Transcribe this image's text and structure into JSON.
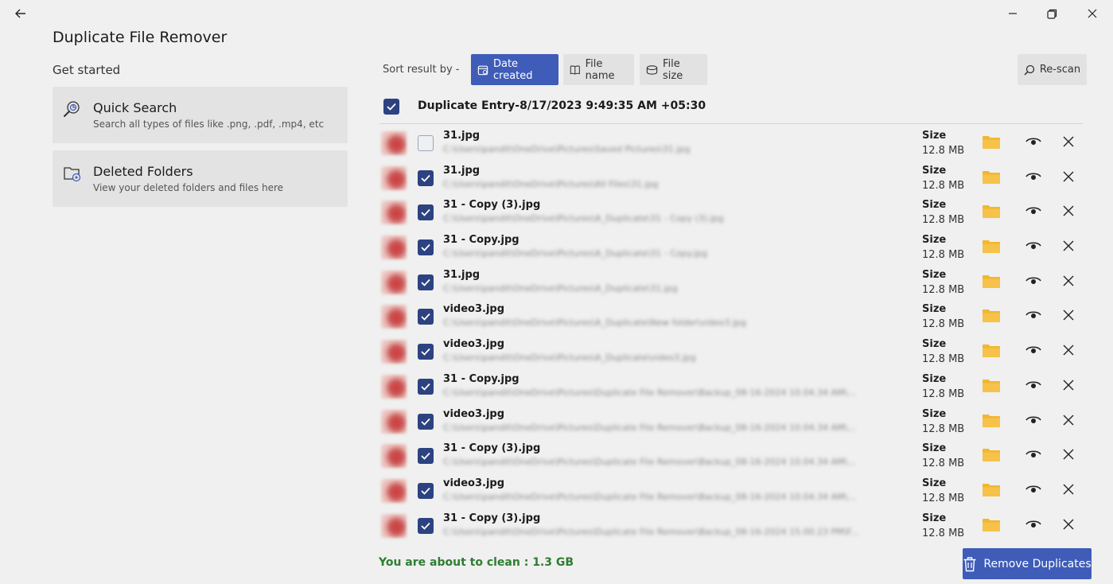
{
  "app": {
    "title": "Duplicate File Remover",
    "get_started": "Get started"
  },
  "sidebar": {
    "cards": [
      {
        "title": "Quick Search",
        "subtitle": "Search all types of files like .png, .pdf, .mp4, etc",
        "icon": "magnifier-search-icon"
      },
      {
        "title": "Deleted Folders",
        "subtitle": "View your deleted folders and files here",
        "icon": "folder-settings-icon"
      }
    ]
  },
  "sort": {
    "label": "Sort result by -",
    "options": [
      {
        "label": "Date created",
        "icon": "calendar-icon",
        "active": true
      },
      {
        "label": "File name",
        "icon": "book-icon",
        "active": false
      },
      {
        "label": "File size",
        "icon": "database-icon",
        "active": false
      }
    ],
    "rescan_label": "Re-scan"
  },
  "entry": {
    "title": "Duplicate Entry-8/17/2023 9:49:35 AM +05:30",
    "checked": true
  },
  "rows": [
    {
      "name": "31.jpg",
      "path": "C:\\Users\\pandit\\OneDrive\\Pictures\\Saved Pictures\\31.jpg",
      "size_label": "Size",
      "size": "12.8 MB",
      "checked": false
    },
    {
      "name": "31.jpg",
      "path": "C:\\Users\\pandit\\OneDrive\\Pictures\\All Files\\31.jpg",
      "size_label": "Size",
      "size": "12.8 MB",
      "checked": true
    },
    {
      "name": "31 - Copy (3).jpg",
      "path": "C:\\Users\\pandit\\OneDrive\\Pictures\\A_Duplicate\\31 - Copy (3).jpg",
      "size_label": "Size",
      "size": "12.8 MB",
      "checked": true
    },
    {
      "name": "31 - Copy.jpg",
      "path": "C:\\Users\\pandit\\OneDrive\\Pictures\\A_Duplicate\\31 - Copy.jpg",
      "size_label": "Size",
      "size": "12.8 MB",
      "checked": true
    },
    {
      "name": "31.jpg",
      "path": "C:\\Users\\pandit\\OneDrive\\Pictures\\A_Duplicate\\31.jpg",
      "size_label": "Size",
      "size": "12.8 MB",
      "checked": true
    },
    {
      "name": "video3.jpg",
      "path": "C:\\Users\\pandit\\OneDrive\\Pictures\\A_Duplicate\\New folder\\video3.jpg",
      "size_label": "Size",
      "size": "12.8 MB",
      "checked": true
    },
    {
      "name": "video3.jpg",
      "path": "C:\\Users\\pandit\\OneDrive\\Pictures\\A_Duplicate\\video3.jpg",
      "size_label": "Size",
      "size": "12.8 MB",
      "checked": true
    },
    {
      "name": "31 - Copy.jpg",
      "path": "C:\\Users\\pandit\\OneDrive\\Pictures\\Duplicate File Remover\\Backup_08-16-2024 10.04.34 AM\\...",
      "size_label": "Size",
      "size": "12.8 MB",
      "checked": true
    },
    {
      "name": "video3.jpg",
      "path": "C:\\Users\\pandit\\OneDrive\\Pictures\\Duplicate File Remover\\Backup_08-16-2024 10.04.34 AM\\...",
      "size_label": "Size",
      "size": "12.8 MB",
      "checked": true
    },
    {
      "name": "31 - Copy (3).jpg",
      "path": "C:\\Users\\pandit\\OneDrive\\Pictures\\Duplicate File Remover\\Backup_08-16-2024 10.04.34 AM\\...",
      "size_label": "Size",
      "size": "12.8 MB",
      "checked": true
    },
    {
      "name": "video3.jpg",
      "path": "C:\\Users\\pandit\\OneDrive\\Pictures\\Duplicate File Remover\\Backup_08-16-2024 10.04.34 AM\\...",
      "size_label": "Size",
      "size": "12.8 MB",
      "checked": true
    },
    {
      "name": "31 - Copy (3).jpg",
      "path": "C:\\Users\\pandit\\OneDrive\\Pictures\\Duplicate File Remover\\Backup_08-16-2024 15.00.23 PM\\F...",
      "size_label": "Size",
      "size": "12.8 MB",
      "checked": true
    }
  ],
  "footer": {
    "clean_label": "You are about to clean :  1.3 GB",
    "remove_label": "Remove Duplicates"
  },
  "colors": {
    "accent": "#3e5cb8",
    "checkbox": "#2c4281",
    "folder": "#f2b630",
    "success": "#2e7d32"
  }
}
